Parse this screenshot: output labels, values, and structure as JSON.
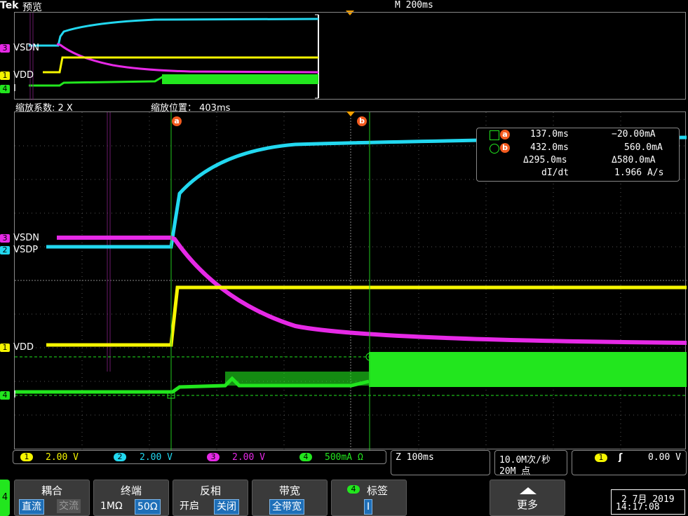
{
  "header": {
    "brand": "Tek",
    "preview_label": "预览",
    "timebase": "M 200ms"
  },
  "zoom": {
    "factor_label": "缩放系数: 2 X",
    "position_label": "缩放位置： 403ms"
  },
  "channels": {
    "ch3_label": "VSDN",
    "ch2_label": "VSDP",
    "ch1_label": "VDD",
    "ch4_label": "I",
    "ch3_num": "3",
    "ch2_num": "2",
    "ch1_num": "1",
    "ch4_num": "4"
  },
  "cursors": {
    "a_label": "a",
    "b_label": "b",
    "a_time": "137.0ms",
    "a_value": "−20.00mA",
    "b_time": "432.0ms",
    "b_value": "560.0mA",
    "delta_time": "Δ295.0ms",
    "delta_value": "Δ580.0mA",
    "didt_label": "dI/dt",
    "didt_value": "1.966 A/s"
  },
  "scale_bar": {
    "ch1": "2.00 V",
    "ch2": "2.00 V",
    "ch3": "2.00 V",
    "ch4": "500mA Ω",
    "horiz": "Z 100ms",
    "rate_line1": "10.0M次/秒",
    "rate_line2": "20M 点",
    "trig_ch": "1",
    "trig_slope": "ʃ",
    "trig_level": "0.00 V"
  },
  "softkeys": {
    "ch_num": "4",
    "coupling": {
      "title": "耦合",
      "opt1": "直流",
      "opt2": "交流"
    },
    "termination": {
      "title": "终端",
      "opt1": "1MΩ",
      "opt2": "50Ω"
    },
    "invert": {
      "title": "反相",
      "opt1": "开启",
      "opt2": "关闭"
    },
    "bandwidth": {
      "title": "带宽",
      "opt1": "全带宽"
    },
    "label": {
      "title": "标签",
      "ch": "4",
      "value": "I"
    },
    "more": {
      "title": "更多"
    }
  },
  "datetime": {
    "date": "2 7月 2019",
    "time": "14:17:08"
  },
  "colors": {
    "ch1": "#f5f500",
    "ch2": "#22d8f0",
    "ch3": "#e629e6",
    "ch4": "#22e61e",
    "cursor": "#f25a1e",
    "softkey_sel": "#1e6fb8"
  }
}
